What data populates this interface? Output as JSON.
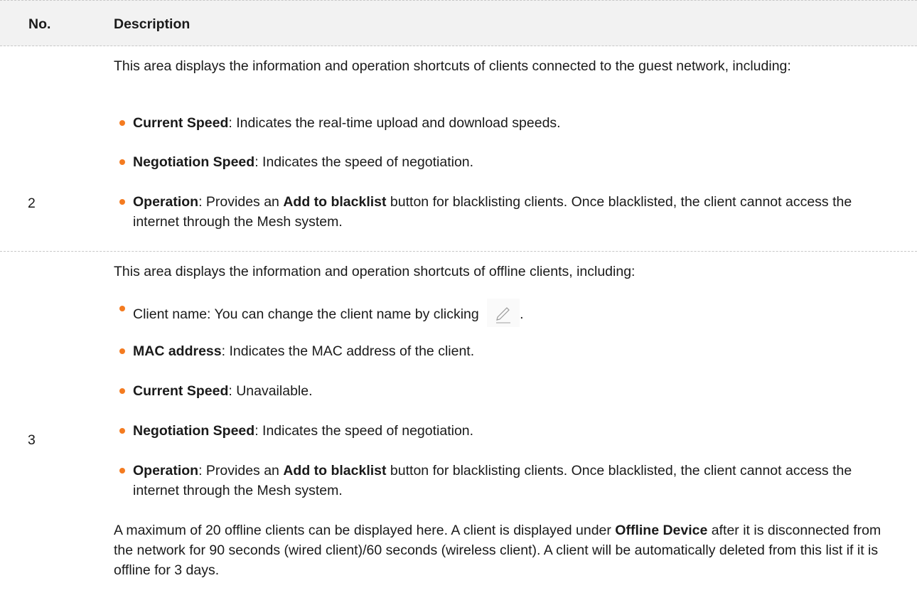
{
  "header": {
    "col_no": "No.",
    "col_desc": "Description"
  },
  "row2": {
    "no": "2",
    "intro": "This area displays the information and operation shortcuts of clients connected to the guest network, including:",
    "items": [
      {
        "term": "Current Speed",
        "text": ": Indicates the real-time upload and download speeds."
      },
      {
        "term": "Negotiation Speed",
        "text": ": Indicates the speed of negotiation."
      },
      {
        "term": "Operation",
        "text1": ": Provides an ",
        "term2": "Add to blacklist",
        "text2": " button for blacklisting clients. Once blacklisted, the client cannot access the internet through the Mesh system."
      }
    ]
  },
  "row3": {
    "no": "3",
    "intro": "This area displays the information and operation shortcuts of offline clients, including:",
    "client_name": {
      "text": "Client name: You can change the client name by clicking",
      "after": ".",
      "icon": "pencil-edit-icon"
    },
    "items": [
      {
        "term": "MAC address",
        "text": ": Indicates the MAC address of the client."
      },
      {
        "term": "Current Speed",
        "text": ": Unavailable."
      },
      {
        "term": "Negotiation Speed",
        "text": ": Indicates the speed of negotiation."
      },
      {
        "term": "Operation",
        "text1": ": Provides an ",
        "term2": "Add to blacklist",
        "text2": " button for blacklisting clients. Once blacklisted, the client cannot access the internet through the Mesh system."
      }
    ],
    "note": {
      "text1": "A maximum of 20 offline clients can be displayed here. A client is displayed under ",
      "term": "Offline Device",
      "text2": " after it is disconnected from the network for 90 seconds (wired client)/60 seconds (wireless client). A client will be automatically deleted from this list if it is offline for 3 days."
    }
  },
  "colors": {
    "bullet": "#f47b20",
    "header_bg": "#f2f2f2"
  }
}
